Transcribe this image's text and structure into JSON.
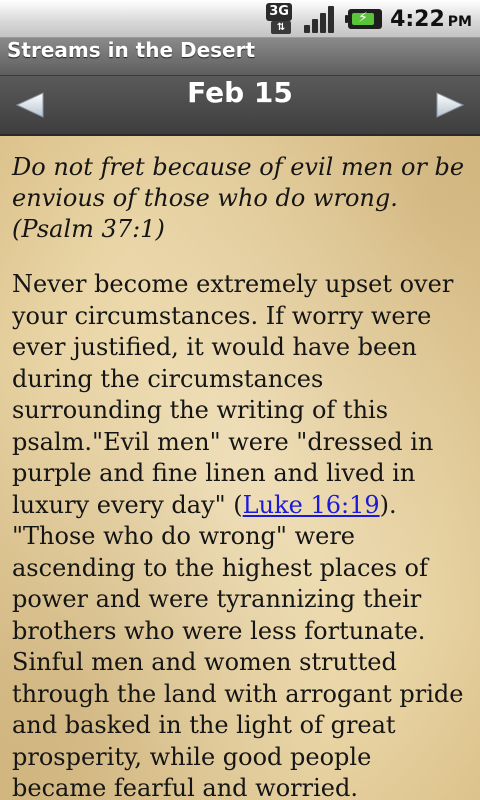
{
  "status_bar": {
    "network_label": "3G",
    "network_arrows": "⇅",
    "time": "4:22",
    "ampm": "PM"
  },
  "app": {
    "title": "Streams in the Desert"
  },
  "nav": {
    "date": "Feb 15"
  },
  "content": {
    "verse": "Do not fret because of evil men or be envious of those who do wrong. (Psalm 37:1)",
    "devotion_before_link": "Never become extremely upset over your circumstances. If worry were ever justified, it would have been during the circumstances surrounding the writing of this psalm.\"Evil men\" were \"dressed in purple and fine linen and lived in luxury every day\" (",
    "link_text": "Luke 16:19",
    "devotion_after_link": "). \"Those who do wrong\" were ascending to the highest places of power and were tyrannizing their brothers who were less fortunate. Sinful men and women strutted through the land with arrogant pride and basked in the light of great prosperity, while good people became fearful and worried."
  },
  "colors": {
    "link": "#1a1ad8",
    "battery": "#59c43a",
    "parchment": "#ecd9ab"
  }
}
